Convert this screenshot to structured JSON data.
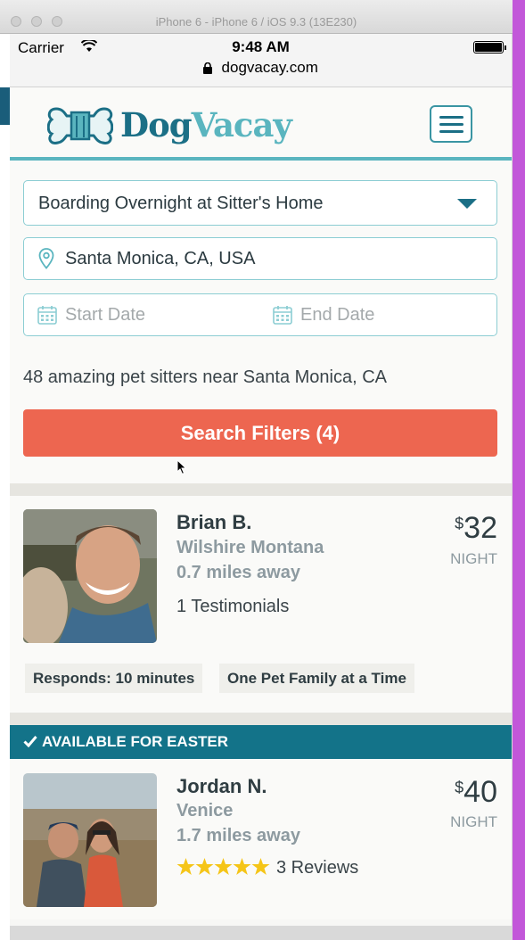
{
  "window": {
    "title": "iPhone 6 - iPhone 6 / iOS 9.3 (13E230)"
  },
  "status_bar": {
    "carrier": "Carrier",
    "time": "9:48 AM"
  },
  "browser": {
    "url": "dogvacay.com"
  },
  "header": {
    "logo_part1": "Dog",
    "logo_part2": "Vacay",
    "menu_icon": "hamburger-icon"
  },
  "search": {
    "service": "Boarding Overnight at Sitter's Home",
    "location": "Santa Monica, CA, USA",
    "start_placeholder": "Start Date",
    "end_placeholder": "End Date",
    "results_text": "48 amazing pet sitters near Santa Monica, CA",
    "filter_button": "Search Filters (4)"
  },
  "listings": [
    {
      "name": "Brian B.",
      "neighborhood": "Wilshire Montana",
      "distance": "0.7 miles away",
      "testimonials": "1 Testimonials",
      "currency": "$",
      "price": "32",
      "unit": "NIGHT",
      "tags": [
        "Responds: 10 minutes",
        "One Pet Family at a Time"
      ]
    },
    {
      "banner": "AVAILABLE FOR EASTER",
      "name": "Jordan N.",
      "neighborhood": "Venice",
      "distance": "1.7 miles away",
      "rating": 5,
      "reviews": "3 Reviews",
      "currency": "$",
      "price": "40",
      "unit": "NIGHT"
    }
  ],
  "colors": {
    "brand_dark": "#1b6f86",
    "brand_light": "#5ab5bf",
    "cta": "#ed6650",
    "banner": "#137389",
    "star": "#f5c518"
  }
}
